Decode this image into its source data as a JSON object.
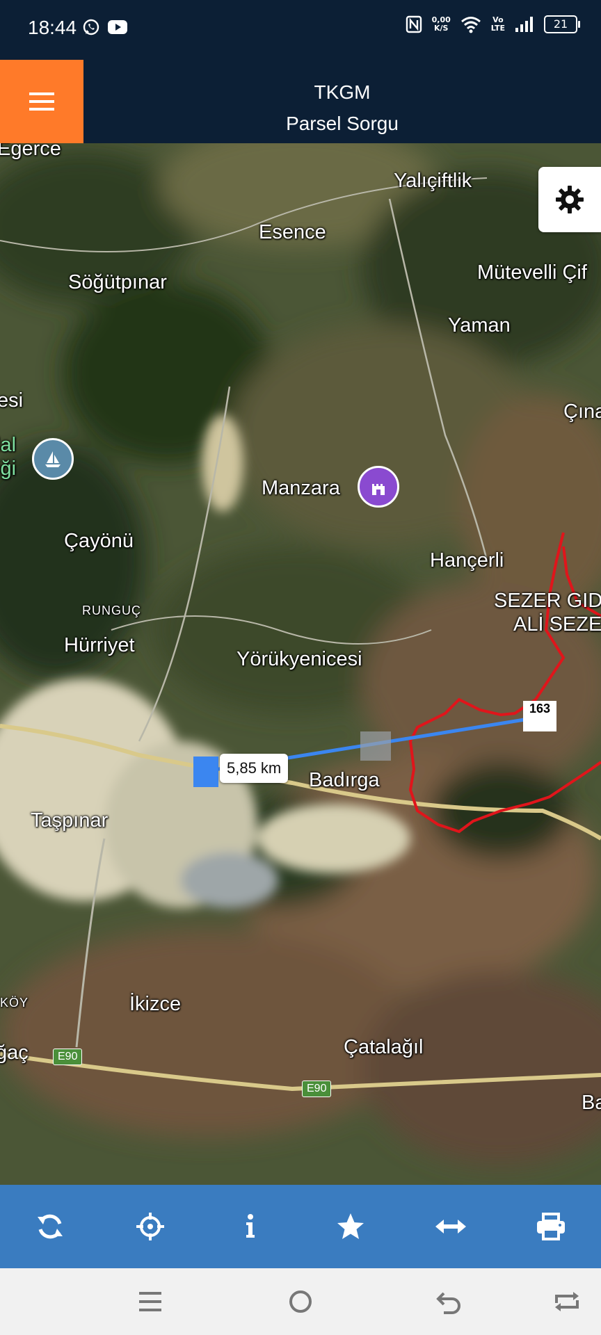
{
  "status_bar": {
    "time": "18:44",
    "left_icons": [
      "whatsapp-icon",
      "youtube-icon"
    ],
    "right_icons": [
      "nfc-icon",
      "data-speed",
      "wifi-icon",
      "volte-icon",
      "signal-icon",
      "battery-icon"
    ],
    "data_speed_value": "0,00",
    "data_speed_unit": "K/S",
    "volte_top": "Vo",
    "volte_bottom": "LTE",
    "battery": "21"
  },
  "header": {
    "title": "TKGM",
    "subtitle": "Parsel Sorgu",
    "menu_icon": "hamburger-icon",
    "accent_color": "#ff7a29",
    "bg_color": "#0c1f35"
  },
  "map": {
    "places": [
      {
        "id": "egerce",
        "label": "Egerce"
      },
      {
        "id": "yaliciftlik",
        "label": "Yalıçiftlik"
      },
      {
        "id": "esence",
        "label": "Esence"
      },
      {
        "id": "sogutpinar",
        "label": "Söğütpınar"
      },
      {
        "id": "mutevelli",
        "label": "Mütevelli Çif"
      },
      {
        "id": "yaman",
        "label": "Yaman"
      },
      {
        "id": "esi",
        "label": "esi"
      },
      {
        "id": "cina",
        "label": "Çına"
      },
      {
        "id": "lal",
        "label": "lal"
      },
      {
        "id": "igi",
        "label": "iği"
      },
      {
        "id": "manzara",
        "label": "Manzara"
      },
      {
        "id": "cayonu",
        "label": "Çayönü"
      },
      {
        "id": "hancerli",
        "label": "Hançerli"
      },
      {
        "id": "sezer1",
        "label": "SEZER GID"
      },
      {
        "id": "sezer2",
        "label": "ALİ SEZE"
      },
      {
        "id": "runguc",
        "label": "RUNGUÇ"
      },
      {
        "id": "hurriyet",
        "label": "Hürriyet"
      },
      {
        "id": "yorukyenicesi",
        "label": "Yörükyenicesi"
      },
      {
        "id": "badirga",
        "label": "Badırga"
      },
      {
        "id": "taspinar",
        "label": "Taşpınar"
      },
      {
        "id": "ikoy",
        "label": "İKÖY"
      },
      {
        "id": "ikizce",
        "label": "İkizce"
      },
      {
        "id": "agac",
        "label": "ğaç"
      },
      {
        "id": "catalagil",
        "label": "Çatalağıl"
      },
      {
        "id": "ba",
        "label": "Ba"
      }
    ],
    "road_badges": [
      "E90",
      "E90"
    ],
    "distance_label": "5,85 km",
    "parcel_label": "163",
    "parcel_color": "#e0151b",
    "measure_line_color": "#3b86f0",
    "settings_icon": "gear-icon",
    "poi_icons": [
      "sailboat-icon",
      "castle-icon"
    ]
  },
  "toolbar": {
    "bg_color": "#3a7cc0",
    "items": [
      {
        "name": "refresh",
        "icon": "refresh-icon"
      },
      {
        "name": "locate",
        "icon": "crosshair-icon"
      },
      {
        "name": "info",
        "icon": "info-icon"
      },
      {
        "name": "favorite",
        "icon": "star-icon"
      },
      {
        "name": "measure",
        "icon": "arrows-horizontal-icon"
      },
      {
        "name": "print",
        "icon": "printer-icon"
      }
    ]
  },
  "nav_bar": {
    "items": [
      "recent-apps-icon",
      "home-icon",
      "back-icon",
      "rotate-icon"
    ]
  }
}
